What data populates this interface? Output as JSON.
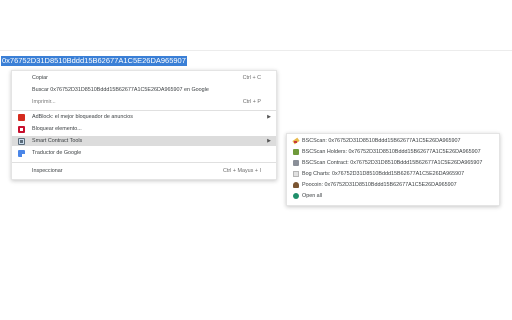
{
  "selected_text": "0x76752D31D8510Bddd15B62677A1C5E26DA965907",
  "menu": {
    "items": [
      {
        "label": "Copiar",
        "shortcut": "Ctrl + C"
      },
      {
        "label": "Buscar 0x76752D31D8510Bddd15B62677A1C5E26DA965907 en Google"
      },
      {
        "label": "Imprimir...",
        "shortcut": "Ctrl + P"
      },
      {
        "label": "AdBlock: el mejor bloqueador de anuncios",
        "icon": "adblock-icon"
      },
      {
        "label": "Bloquear elemento...",
        "icon": "element-blocker-icon"
      },
      {
        "label": "Smart Contract Tools",
        "icon": "smart-contract-tools-icon"
      },
      {
        "label": "Traductor de Google",
        "icon": "google-translate-icon"
      },
      {
        "label": "Inspeccionar",
        "shortcut": "Ctrl + Mayus + I"
      }
    ]
  },
  "submenu": {
    "items": [
      {
        "label": "BSCScan: 0x76752D31D8510Bddd15B62677A1C5E26DA965907",
        "icon": "bscscan-icon"
      },
      {
        "label": "BSCScan Holders: 0x76752D31D8510Bddd15B62677A1C5E26DA965907",
        "icon": "bscscan-holders-icon"
      },
      {
        "label": "BSCScan Contract: 0x76752D31D8510Bddd15B62677A1C5E26DA965907",
        "icon": "bscscan-contract-icon"
      },
      {
        "label": "Bog Charts: 0x76752D31D8510Bddd15B62677A1C5E26DA965907",
        "icon": "bogged-charts-icon"
      },
      {
        "label": "Poocoin: 0x76752D31D8510Bddd15B62677A1C5E26DA965907",
        "icon": "poocoin-icon"
      },
      {
        "label": "Open all",
        "icon": "open-all-icon"
      }
    ]
  }
}
